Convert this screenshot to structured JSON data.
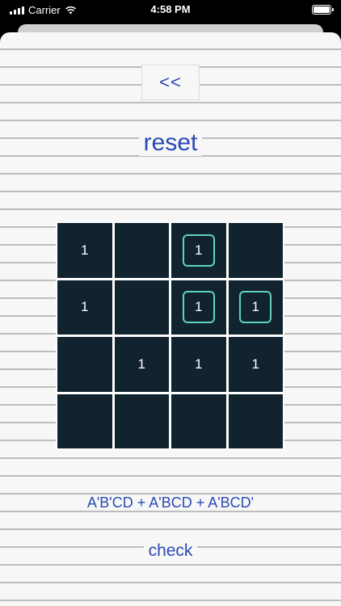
{
  "status_bar": {
    "carrier": "Carrier",
    "time": "4:58 PM"
  },
  "nav": {
    "back_label": "<<"
  },
  "reset_label": "reset",
  "kmap": {
    "cells": [
      {
        "value": "1",
        "selected": false
      },
      {
        "value": "",
        "selected": false
      },
      {
        "value": "1",
        "selected": true
      },
      {
        "value": "",
        "selected": false
      },
      {
        "value": "1",
        "selected": false
      },
      {
        "value": "",
        "selected": false
      },
      {
        "value": "1",
        "selected": true
      },
      {
        "value": "1",
        "selected": true
      },
      {
        "value": "",
        "selected": false
      },
      {
        "value": "1",
        "selected": false
      },
      {
        "value": "1",
        "selected": false
      },
      {
        "value": "1",
        "selected": false
      },
      {
        "value": "",
        "selected": false
      },
      {
        "value": "",
        "selected": false
      },
      {
        "value": "",
        "selected": false
      },
      {
        "value": "",
        "selected": false
      }
    ]
  },
  "expression": "A'B'CD + A'BCD + A'BCD'",
  "check_label": "check",
  "colors": {
    "accent": "#2b49b5",
    "cell_bg": "#11232f",
    "selection": "#5fd3bd"
  }
}
